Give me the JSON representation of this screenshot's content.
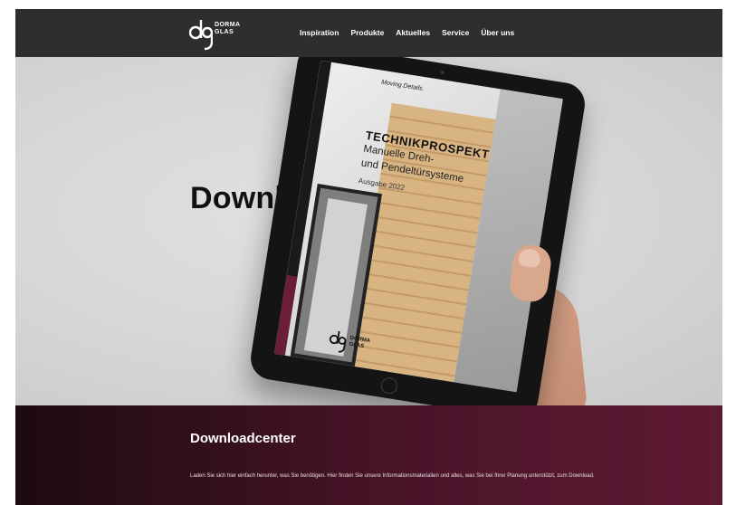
{
  "header": {
    "logo": {
      "line1": "DORMA",
      "line2": "GLAS",
      "icon": "dg-logo-icon"
    },
    "nav": [
      "Inspiration",
      "Produkte",
      "Aktuelles",
      "Service",
      "Über uns"
    ]
  },
  "hero": {
    "title": "Downloadcenter",
    "tablet": {
      "tagline": "Moving Details.",
      "title": "TECHNIKPROSPEKT",
      "subtitle_line1": "Manuelle Dreh-",
      "subtitle_line2": "und Pendeltürsysteme",
      "edition": "Ausgabe 2022",
      "logo_line1": "DORMA",
      "logo_line2": "GLAS"
    }
  },
  "section": {
    "title": "Downloadcenter",
    "text": "Laden Sie sich hier einfach herunter, was Sie benötigen. Hier finden Sie unsere Informationsmaterialien und alles, was Sie bei Ihrer Planung unterstützt, zum Download."
  },
  "colors": {
    "header_bg": "#2e2e2e",
    "accent": "#5d1a33",
    "hero_bg": "#d6d6d6"
  }
}
